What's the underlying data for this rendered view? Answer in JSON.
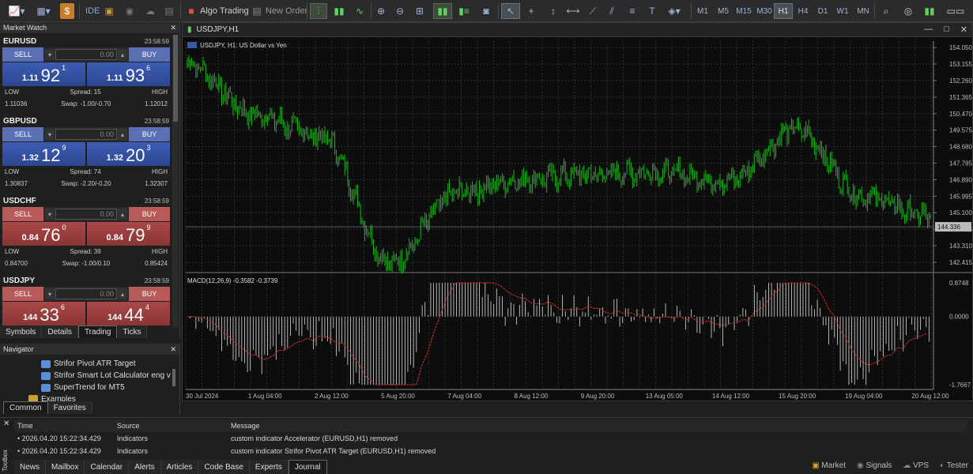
{
  "toolbar": {
    "algo_label": "Algo Trading",
    "new_order_label": "New Order",
    "ide_label": "IDE",
    "timeframes": [
      "M1",
      "M5",
      "M15",
      "M30",
      "H1",
      "H4",
      "D1",
      "W1",
      "MN"
    ],
    "active_timeframe": "H1"
  },
  "market_watch": {
    "title": "Market Watch",
    "symbols": [
      {
        "name": "EURUSD",
        "time": "23:58:59",
        "sell": "SELL",
        "buy": "BUY",
        "lot": "0.00",
        "bid_small": "1.11",
        "bid_big": "92",
        "bid_sup": "1",
        "ask_small": "1.11",
        "ask_big": "93",
        "ask_sup": "6",
        "low": "1.11036",
        "spread": "Spread: 15",
        "swap": "Swap: -1.00/-0.70",
        "high": "1.12012",
        "low_label": "LOW",
        "high_label": "HIGH",
        "color": "blue"
      },
      {
        "name": "GBPUSD",
        "time": "23:58:59",
        "sell": "SELL",
        "buy": "BUY",
        "lot": "0.00",
        "bid_small": "1.32",
        "bid_big": "12",
        "bid_sup": "9",
        "ask_small": "1.32",
        "ask_big": "20",
        "ask_sup": "3",
        "low": "1.30837",
        "spread": "Spread: 74",
        "swap": "Swap: -2.20/-0.20",
        "high": "1.32307",
        "low_label": "LOW",
        "high_label": "HIGH",
        "color": "blue"
      },
      {
        "name": "USDCHF",
        "time": "23:58:59",
        "sell": "SELL",
        "buy": "BUY",
        "lot": "0.00",
        "bid_small": "0.84",
        "bid_big": "76",
        "bid_sup": "0",
        "ask_small": "0.84",
        "ask_big": "79",
        "ask_sup": "9",
        "low": "0.84700",
        "spread": "Spread: 39",
        "swap": "Swap: -1.00/0.10",
        "high": "0.85424",
        "low_label": "LOW",
        "high_label": "HIGH",
        "color": "red"
      },
      {
        "name": "USDJPY",
        "time": "23:58:59",
        "sell": "SELL",
        "buy": "BUY",
        "lot": "0.00",
        "bid_small": "144",
        "bid_big": "33",
        "bid_sup": "6",
        "ask_small": "144",
        "ask_big": "44",
        "ask_sup": "4",
        "color": "red"
      }
    ],
    "tabs": [
      "Symbols",
      "Details",
      "Trading",
      "Ticks"
    ],
    "active_tab": "Trading"
  },
  "navigator": {
    "title": "Navigator",
    "items": [
      "Strifor Pivot ATR Target",
      "Strifor Smart Lot Calculator eng v",
      "SuperTrend for MT5",
      "Examples"
    ],
    "tabs": [
      "Common",
      "Favorites"
    ]
  },
  "chart": {
    "window_title": "USDJPY,H1",
    "symbol_label": "USDJPY, H1:  US Dollar vs Yen",
    "macd_label": "MACD(12,26,9) -0.3582 -0.3739",
    "price_ticks": [
      "154.050",
      "153.155",
      "152.260",
      "151.365",
      "150.470",
      "149.575",
      "148.680",
      "147.785",
      "146.890",
      "145.995",
      "145.100",
      "144.205",
      "143.310",
      "142.415"
    ],
    "current_price": "144.336",
    "macd_ticks": [
      "0.8748",
      "0.0000",
      "-1.7667"
    ],
    "date_ticks": [
      "30 Jul 2024",
      "1 Aug 04:00",
      "2 Aug 12:00",
      "5 Aug 20:00",
      "7 Aug 04:00",
      "8 Aug 12:00",
      "9 Aug 20:00",
      "13 Aug 05:00",
      "14 Aug 12:00",
      "15 Aug 20:00",
      "19 Aug 04:00",
      "20 Aug 12:00"
    ]
  },
  "toolbox": {
    "label": "Toolbox",
    "columns": [
      "Time",
      "Source",
      "Message"
    ],
    "rows": [
      {
        "time": "2026.04.20 15:22:34.429",
        "source": "Indicators",
        "message": "custom indicator Accelerator (EURUSD,H1) removed"
      },
      {
        "time": "2026.04.20 15:22:34.429",
        "source": "Indicators",
        "message": "custom indicator Strifor Pivot ATR Target (EURUSD,H1) removed"
      }
    ],
    "tabs": [
      "News",
      "Mailbox",
      "Calendar",
      "Alerts",
      "Articles",
      "Code Base",
      "Experts",
      "Journal"
    ],
    "active_tab": "Journal"
  },
  "status": {
    "market": "Market",
    "signals": "Signals",
    "vps": "VPS",
    "tester": "Tester"
  },
  "chart_data": {
    "type": "line",
    "title": "USDJPY, H1:  US Dollar vs Yen",
    "ylim": [
      141.9,
      154.4
    ],
    "x": [
      "30 Jul 2024",
      "1 Aug 04:00",
      "2 Aug 12:00",
      "5 Aug 20:00",
      "7 Aug 04:00",
      "8 Aug 12:00",
      "9 Aug 20:00",
      "13 Aug 05:00",
      "14 Aug 12:00",
      "15 Aug 20:00",
      "19 Aug 04:00",
      "20 Aug 12:00"
    ],
    "series": [
      {
        "values": [
          153.2,
          150.4,
          149.2,
          142.4,
          146.2,
          146.9,
          147.2,
          147.3,
          146.8,
          149.6,
          146.0,
          144.9
        ]
      }
    ],
    "macd_ylim": [
      -1.7667,
      0.8748
    ]
  }
}
